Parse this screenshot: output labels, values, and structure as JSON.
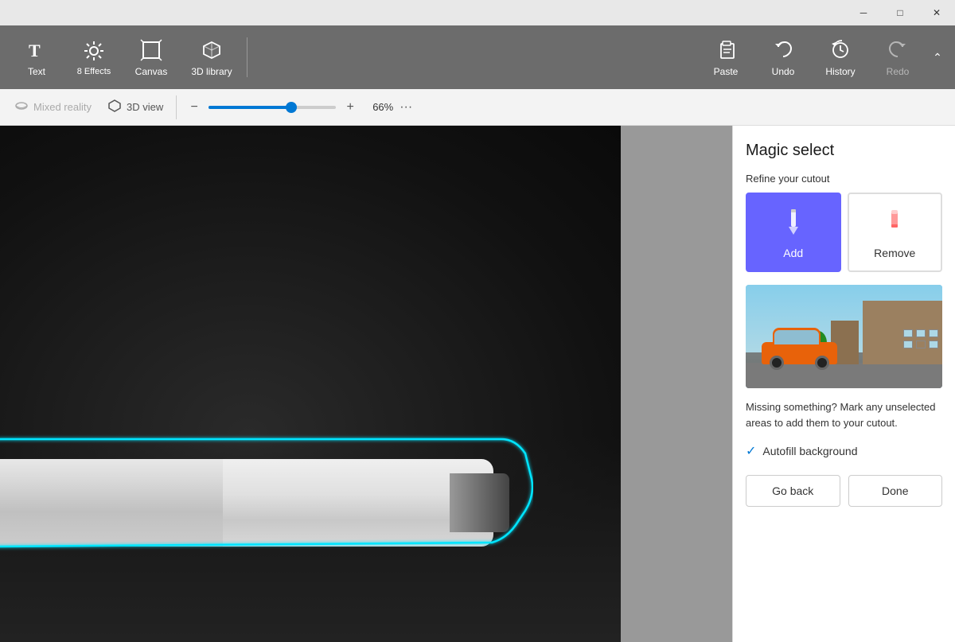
{
  "titlebar": {
    "minimize_label": "─",
    "maximize_label": "□",
    "close_label": "✕"
  },
  "toolbar": {
    "text_label": "Text",
    "effects_label": "Effects",
    "effects_badge": "8 Effects",
    "canvas_label": "Canvas",
    "library_label": "3D library",
    "paste_label": "Paste",
    "undo_label": "Undo",
    "history_label": "History",
    "redo_label": "Redo"
  },
  "secondary_toolbar": {
    "mixed_reality_label": "Mixed reality",
    "view_3d_label": "3D view",
    "zoom_percent": "66%",
    "zoom_value": 65
  },
  "right_panel": {
    "title": "Magic select",
    "refine_label": "Refine your cutout",
    "add_label": "Add",
    "remove_label": "Remove",
    "helper_text": "Missing something? Mark any unselected areas to add them to your cutout.",
    "autofill_label": "Autofill background",
    "go_back_label": "Go back",
    "done_label": "Done"
  }
}
